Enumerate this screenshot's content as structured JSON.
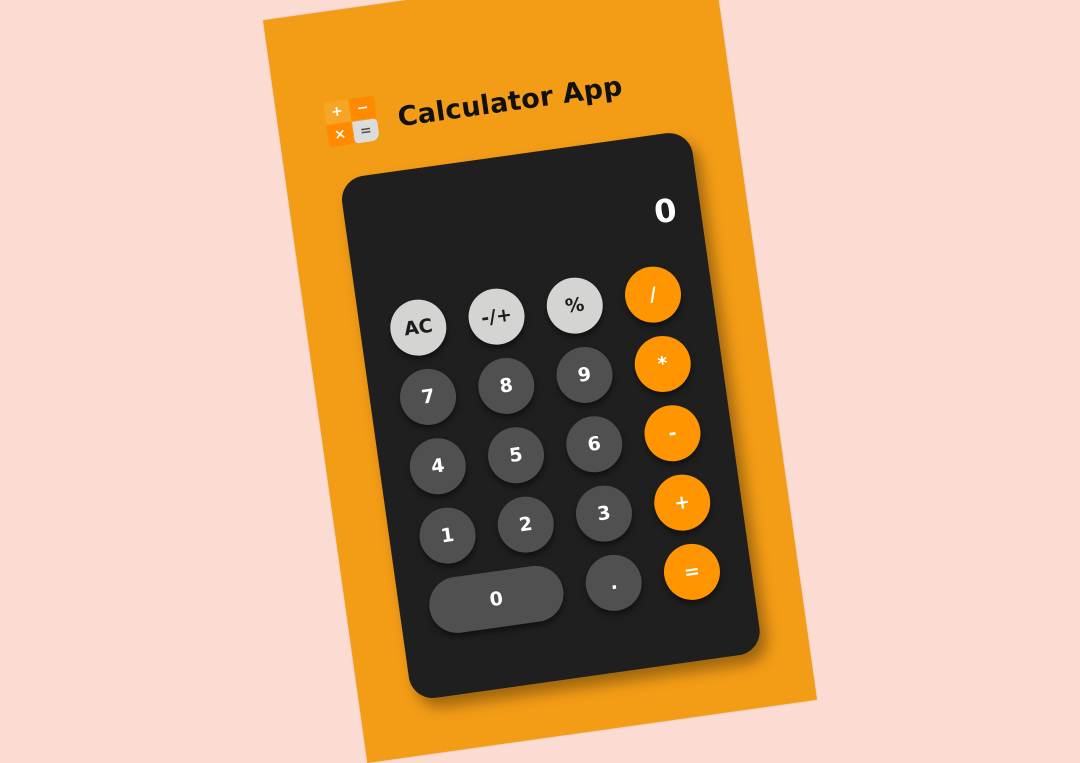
{
  "app": {
    "title": "Calculator App",
    "logo_symbols": [
      "+",
      "−",
      "×",
      "="
    ]
  },
  "display": {
    "value": "0"
  },
  "keys": {
    "row1": [
      "AC",
      "-/+",
      "%",
      "/"
    ],
    "row2": [
      "7",
      "8",
      "9",
      "*"
    ],
    "row3": [
      "4",
      "5",
      "6",
      "-"
    ],
    "row4": [
      "1",
      "2",
      "3",
      "+"
    ],
    "row5": [
      "0",
      ".",
      "="
    ]
  },
  "colors": {
    "background": "#fcdcd2",
    "frame": "#f39c16",
    "panel": "#1f1f1f",
    "number_key": "#505050",
    "function_key": "#d4d4d2",
    "operator_key": "#ff9500"
  }
}
